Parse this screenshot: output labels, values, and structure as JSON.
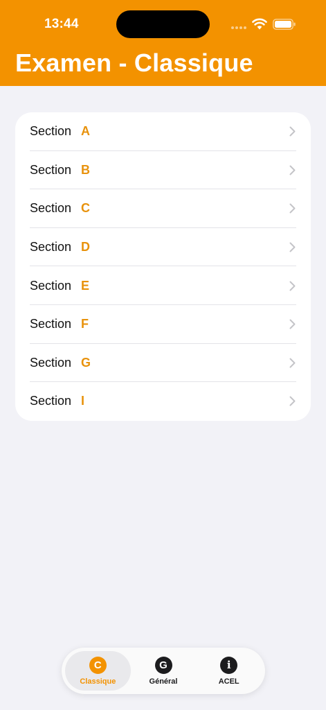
{
  "status_bar": {
    "time": "13:44"
  },
  "header": {
    "title": "Examen - Classique",
    "background_color": "#f39200"
  },
  "sections": [
    {
      "prefix": "Section",
      "letter": "A"
    },
    {
      "prefix": "Section",
      "letter": "B"
    },
    {
      "prefix": "Section",
      "letter": "C"
    },
    {
      "prefix": "Section",
      "letter": "D"
    },
    {
      "prefix": "Section",
      "letter": "E"
    },
    {
      "prefix": "Section",
      "letter": "F"
    },
    {
      "prefix": "Section",
      "letter": "G"
    },
    {
      "prefix": "Section",
      "letter": "I"
    }
  ],
  "tab_bar": {
    "tabs": [
      {
        "icon_glyph": "C",
        "icon": "letter-c-circle-icon",
        "label": "Classique",
        "active": true
      },
      {
        "icon_glyph": "G",
        "icon": "letter-g-circle-icon",
        "label": "Général",
        "active": false
      },
      {
        "icon_glyph": "i",
        "icon": "info-circle-icon",
        "label": "ACEL",
        "active": false
      }
    ]
  },
  "colors": {
    "accent": "#f39200",
    "background": "#f2f2f7",
    "card": "#ffffff"
  }
}
